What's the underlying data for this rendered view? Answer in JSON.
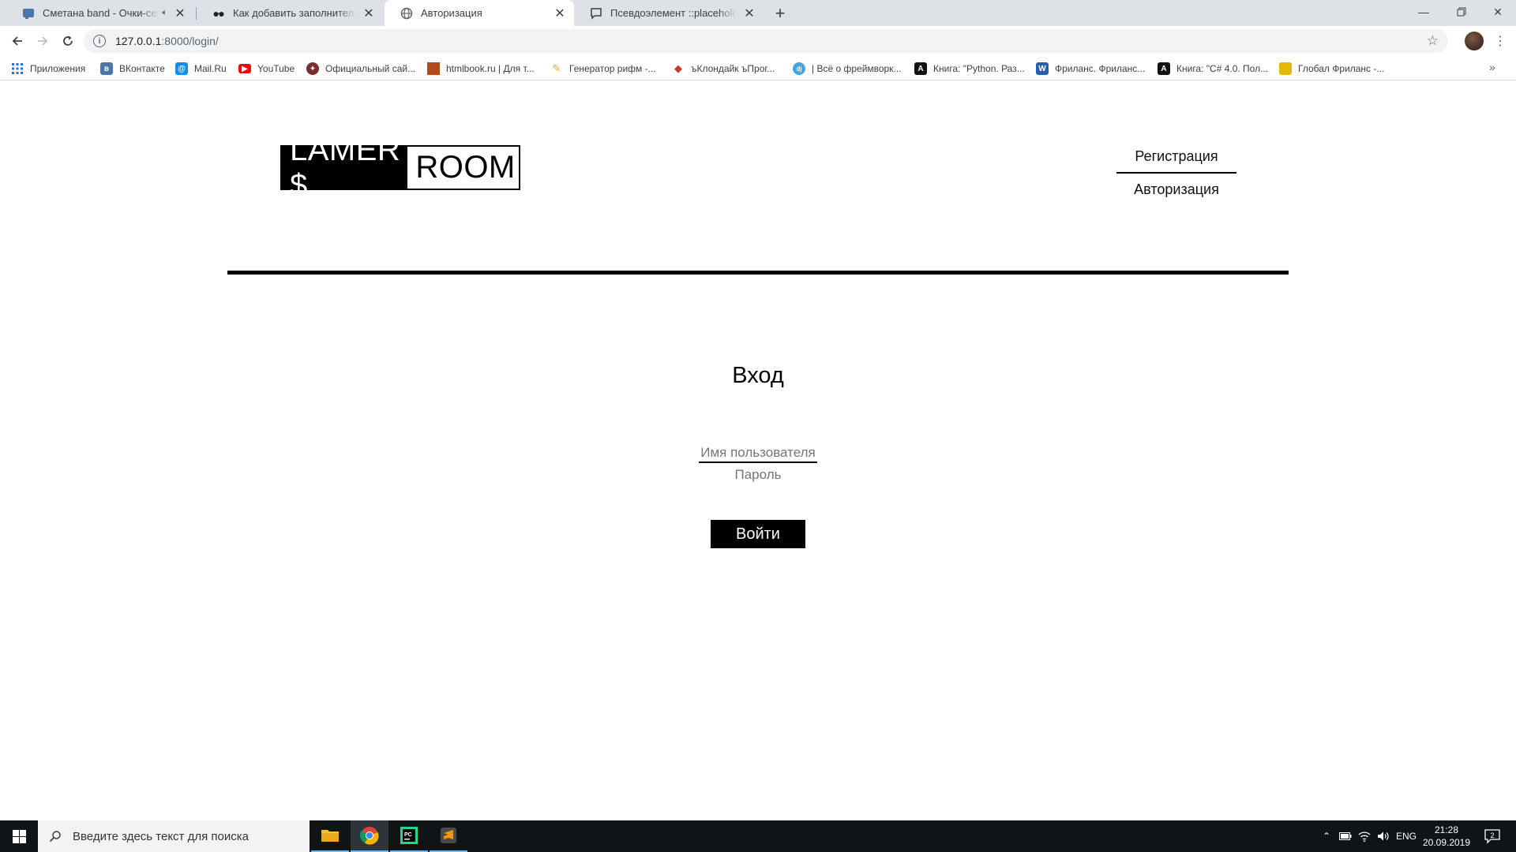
{
  "browser": {
    "tabs": [
      {
        "title": "Сметана band - Очки-сердечки",
        "icon": "vk-icon",
        "icon_color": "#4a76a8",
        "audio": true
      },
      {
        "title": "Как добавить заполнителя в форму",
        "icon": "sunglasses-icon",
        "audio": false
      },
      {
        "title": "Авторизация",
        "icon": "globe-icon",
        "audio": false,
        "active": true
      },
      {
        "title": "Псевдоэлемент ::placeholder | CSS",
        "icon": "comment-icon",
        "audio": false
      }
    ],
    "address": {
      "host": "127.0.0.1",
      "path": ":8000/login/"
    },
    "bookmarks": [
      {
        "label": "Приложения",
        "icon": "apps-grid-icon",
        "color": "#1a73e8"
      },
      {
        "label": "ВКонтакте",
        "icon": "vk-icon",
        "color": "#4a76a8"
      },
      {
        "label": "Mail.Ru",
        "icon": "mailru-icon",
        "color": "#168de2"
      },
      {
        "label": "YouTube",
        "icon": "youtube-icon",
        "color": "#ff0000"
      },
      {
        "label": "Официальный сай...",
        "icon": "shield-icon",
        "color": "#7a2e2e"
      },
      {
        "label": "htmlbook.ru | Для т...",
        "icon": "htmlbook-icon",
        "color": "#b24a1c"
      },
      {
        "label": "Генератор рифм -...",
        "icon": "pencil-icon",
        "color": "#e0a030"
      },
      {
        "label": "ъКлондайк ъПрог...",
        "icon": "gem-icon",
        "color": "#c0392b"
      },
      {
        "label": "| Всё о фреймворк...",
        "icon": "dj-icon",
        "color": "#44a3e0"
      },
      {
        "label": "Книга: \"Python. Раз...",
        "icon": "book-a-icon",
        "color": "#111111"
      },
      {
        "label": "Фриланс. Фриланс...",
        "icon": "w-icon",
        "color": "#2b5fad"
      },
      {
        "label": "Книга: \"C# 4.0. Пол...",
        "icon": "book-a-icon",
        "color": "#111111"
      },
      {
        "label": "Глобал Фриланс -...",
        "icon": "gf-icon",
        "color": "#e6b800"
      }
    ]
  },
  "site": {
    "logo_left": "LAMER $",
    "logo_right": "ROOM",
    "nav": {
      "register": "Регистрация",
      "login": "Авторизация"
    },
    "form": {
      "title": "Вход",
      "username_placeholder": "Имя пользователя",
      "password_placeholder": "Пароль",
      "submit_label": "Войти"
    }
  },
  "taskbar": {
    "search_placeholder": "Введите здесь текст для поиска",
    "language": "ENG",
    "time": "21:28",
    "date": "20.09.2019",
    "notification_count": "2"
  }
}
